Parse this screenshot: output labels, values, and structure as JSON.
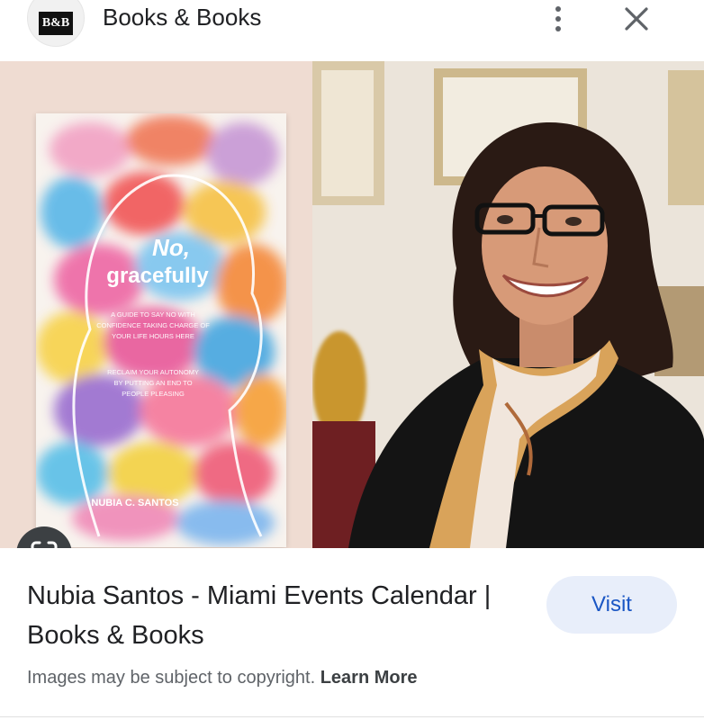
{
  "header": {
    "logo_text": "B&B",
    "site_name": "Books & Books",
    "menu_icon": "more-vert-icon",
    "close_icon": "close-icon"
  },
  "image": {
    "book_title": "No, gracefully",
    "book_text_lines": [
      "A GUIDE TO SAY NO WITH",
      "CONFIDENCE TAKING CHARGE OF",
      "YOUR LIFE HOURS HERE",
      "RECLAIM YOUR AUTONOMY",
      "BY PUTTING AN END TO",
      "PEOPLE PLEASING"
    ],
    "book_author": "NUBIA C. SANTOS",
    "lens_icon": "google-lens-icon"
  },
  "result": {
    "title": "Nubia Santos - Miami Events Calendar | Books & Books",
    "visit_label": "Visit"
  },
  "footer": {
    "copyright_text": "Images may be subject to copyright.",
    "learn_more": "Learn More"
  },
  "colors": {
    "accent_blue": "#1a56c4",
    "visit_bg": "#e8eefa",
    "lens_bg": "#3c4043"
  }
}
